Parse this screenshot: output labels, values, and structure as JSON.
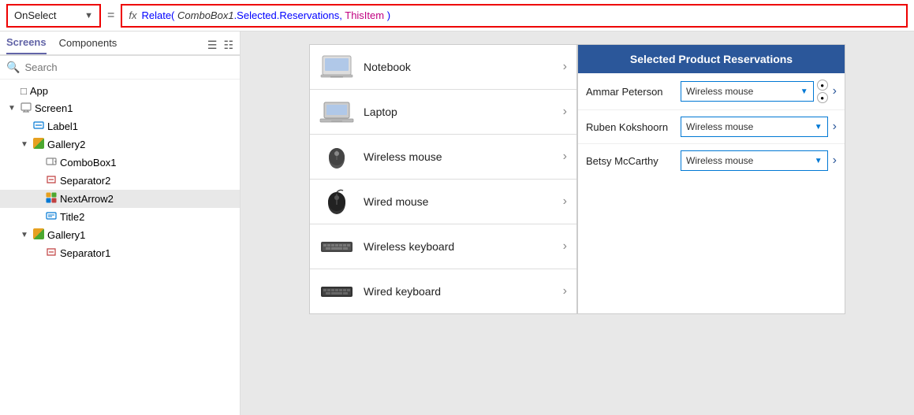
{
  "formulaBar": {
    "dropdown": "OnSelect",
    "equals": "=",
    "fxLabel": "fx",
    "formula_prefix": "Relate(",
    "formula_obj": "ComboBox1",
    "formula_mid": ".Selected.Reservations,",
    "formula_this": "ThisItem",
    "formula_suffix": " )"
  },
  "sidebar": {
    "tabs": [
      {
        "label": "Screens",
        "active": true
      },
      {
        "label": "Components",
        "active": false
      }
    ],
    "search_placeholder": "Search",
    "tree": [
      {
        "id": "app",
        "label": "App",
        "indent": 1,
        "icon": "app",
        "chevron": false
      },
      {
        "id": "screen1",
        "label": "Screen1",
        "indent": 1,
        "icon": "screen",
        "chevron": "open"
      },
      {
        "id": "label1",
        "label": "Label1",
        "indent": 2,
        "icon": "label",
        "chevron": false
      },
      {
        "id": "gallery2",
        "label": "Gallery2",
        "indent": 2,
        "icon": "gallery",
        "chevron": "open"
      },
      {
        "id": "combobox1",
        "label": "ComboBox1",
        "indent": 3,
        "icon": "combobox",
        "chevron": false
      },
      {
        "id": "separator2",
        "label": "Separator2",
        "indent": 3,
        "icon": "separator",
        "chevron": false
      },
      {
        "id": "nextarrow2",
        "label": "NextArrow2",
        "indent": 3,
        "icon": "nextarrow",
        "chevron": false,
        "selected": true
      },
      {
        "id": "title2",
        "label": "Title2",
        "indent": 3,
        "icon": "title",
        "chevron": false
      },
      {
        "id": "gallery1",
        "label": "Gallery1",
        "indent": 2,
        "icon": "gallery",
        "chevron": "open"
      },
      {
        "id": "separator1",
        "label": "Separator1",
        "indent": 3,
        "icon": "separator",
        "chevron": false
      }
    ]
  },
  "products": [
    {
      "name": "Notebook",
      "img": "notebook"
    },
    {
      "name": "Laptop",
      "img": "laptop"
    },
    {
      "name": "Wireless mouse",
      "img": "wmouse"
    },
    {
      "name": "Wired mouse",
      "img": "mouse"
    },
    {
      "name": "Wireless keyboard",
      "img": "wkeyboard"
    },
    {
      "name": "Wired keyboard",
      "img": "keyboard"
    }
  ],
  "reservations": {
    "header": "Selected Product Reservations",
    "rows": [
      {
        "name": "Ammar Peterson",
        "product": "Wireless mouse",
        "hasCircle": true
      },
      {
        "name": "Ruben Kokshoorn",
        "product": "Wireless mouse",
        "hasCircle": false
      },
      {
        "name": "Betsy McCarthy",
        "product": "Wireless mouse",
        "hasCircle": false
      }
    ]
  }
}
